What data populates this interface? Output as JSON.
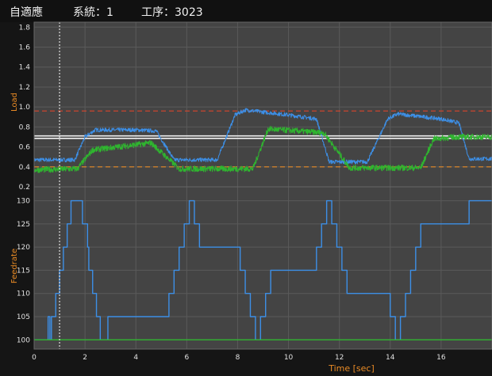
{
  "header": {
    "title": "自適應",
    "system": "系統：1",
    "process": "工序：3023"
  },
  "colors": {
    "background": "#151515",
    "plot_background": "#444444",
    "grid": "#5a5a5a",
    "axis_label": "#e88a25",
    "spindle_load": "#3d8fe6",
    "servo_load": "#2fb52f",
    "upper_limit": "#d9452b",
    "lower_limit": "#e88a25",
    "reference": "#f0f0f0",
    "feedrate": "#3d8fe6",
    "feedrate_base": "#2fb52f"
  },
  "chart_data": [
    {
      "type": "line",
      "title": "",
      "xlabel": "",
      "ylabel": "Load",
      "xlim": [
        0,
        18
      ],
      "ylim": [
        0.2,
        1.85
      ],
      "yticks": [
        0.2,
        0.4,
        0.6,
        0.8,
        1.0,
        1.2,
        1.4,
        1.6,
        1.8
      ],
      "grid": true,
      "reference_lines": [
        {
          "name": "upper-limit",
          "y": 0.96,
          "style": "dashed",
          "color": "#d9452b"
        },
        {
          "name": "lower-limit",
          "y": 0.4,
          "style": "dashed",
          "color": "#e88a25"
        },
        {
          "name": "target-high",
          "y": 0.71,
          "style": "solid",
          "color": "#f0f0f0"
        },
        {
          "name": "target-low",
          "y": 0.685,
          "style": "solid",
          "color": "#f0f0f0"
        }
      ],
      "cursor_x": 1.0,
      "series": [
        {
          "color": "#3d8fe6",
          "noise": 0.02,
          "x": [
            0,
            1.6,
            2.0,
            2.4,
            4.0,
            4.8,
            5.5,
            7.2,
            7.9,
            8.3,
            10.0,
            11.1,
            11.6,
            13.1,
            13.9,
            14.3,
            16.0,
            16.7,
            17.1,
            18.0
          ],
          "y": [
            0.47,
            0.47,
            0.7,
            0.77,
            0.77,
            0.76,
            0.47,
            0.47,
            0.92,
            0.97,
            0.92,
            0.88,
            0.45,
            0.45,
            0.88,
            0.93,
            0.88,
            0.84,
            0.48,
            0.48
          ]
        },
        {
          "color": "#2fb52f",
          "noise": 0.03,
          "x": [
            0,
            1.7,
            2.3,
            4.6,
            5.7,
            8.6,
            9.2,
            11.4,
            12.4,
            15.2,
            15.7,
            16.6,
            18.0
          ],
          "y": [
            0.37,
            0.38,
            0.57,
            0.64,
            0.38,
            0.38,
            0.78,
            0.74,
            0.39,
            0.39,
            0.68,
            0.7,
            0.7
          ]
        }
      ]
    },
    {
      "type": "line",
      "title": "",
      "xlabel": "Time [sec]",
      "ylabel": "Feedrate",
      "xlim": [
        0,
        18
      ],
      "ylim": [
        98,
        133
      ],
      "xticks": [
        0,
        2,
        4,
        6,
        8,
        10,
        12,
        14,
        16
      ],
      "xtick_labels": [
        "0",
        "2",
        "4",
        "6",
        "8",
        "10",
        "12",
        "14",
        "16"
      ],
      "yticks": [
        100,
        105,
        110,
        115,
        120,
        125,
        130
      ],
      "grid": true,
      "cursor_x": 1.0,
      "series": [
        {
          "color": "#3d8fe6",
          "x": [
            0,
            0.55,
            0.55,
            0.62,
            0.62,
            0.68,
            0.68,
            0.85,
            0.85,
            1.0,
            1.0,
            1.15,
            1.15,
            1.3,
            1.3,
            1.45,
            1.45,
            1.6,
            1.6,
            1.75,
            1.75,
            1.9,
            1.9,
            2.1,
            2.1,
            2.15,
            2.15,
            2.3,
            2.3,
            2.45,
            2.45,
            2.6,
            2.6,
            2.75,
            2.75,
            2.9,
            2.9,
            5.3,
            5.3,
            5.5,
            5.5,
            5.7,
            5.7,
            5.9,
            5.9,
            6.1,
            6.1,
            6.3,
            6.3,
            6.5,
            6.5,
            8.1,
            8.1,
            8.3,
            8.3,
            8.5,
            8.5,
            8.7,
            8.7,
            8.9,
            8.9,
            9.1,
            9.1,
            9.3,
            9.3,
            11.1,
            11.1,
            11.3,
            11.3,
            11.5,
            11.5,
            11.7,
            11.7,
            11.9,
            11.9,
            12.1,
            12.1,
            12.3,
            12.3,
            14.0,
            14.0,
            14.2,
            14.2,
            14.4,
            14.4,
            14.6,
            14.6,
            14.8,
            14.8,
            15.0,
            15.0,
            15.2,
            15.2,
            17.1,
            17.1,
            17.3,
            17.3,
            17.5,
            17.5,
            17.7,
            17.7,
            17.9,
            17.9,
            18.0
          ],
          "y": [
            100,
            100,
            105,
            105,
            100,
            100,
            105,
            105,
            110,
            110,
            115,
            115,
            120,
            120,
            125,
            125,
            130,
            130,
            130,
            130,
            130,
            130,
            125,
            125,
            120,
            120,
            115,
            115,
            110,
            110,
            105,
            105,
            100,
            100,
            100,
            100,
            105,
            105,
            110,
            110,
            115,
            115,
            120,
            120,
            125,
            125,
            130,
            130,
            125,
            125,
            120,
            120,
            115,
            115,
            110,
            110,
            105,
            105,
            100,
            100,
            105,
            105,
            110,
            110,
            115,
            115,
            120,
            120,
            125,
            125,
            130,
            130,
            125,
            125,
            120,
            120,
            115,
            115,
            110,
            110,
            105,
            105,
            100,
            100,
            105,
            105,
            110,
            110,
            115,
            115,
            120,
            120,
            125,
            125,
            130,
            130,
            130,
            130,
            130,
            130,
            130,
            130,
            130,
            130
          ]
        },
        {
          "color": "#2fb52f",
          "x": [
            0,
            18
          ],
          "y": [
            100,
            100
          ]
        }
      ]
    }
  ]
}
